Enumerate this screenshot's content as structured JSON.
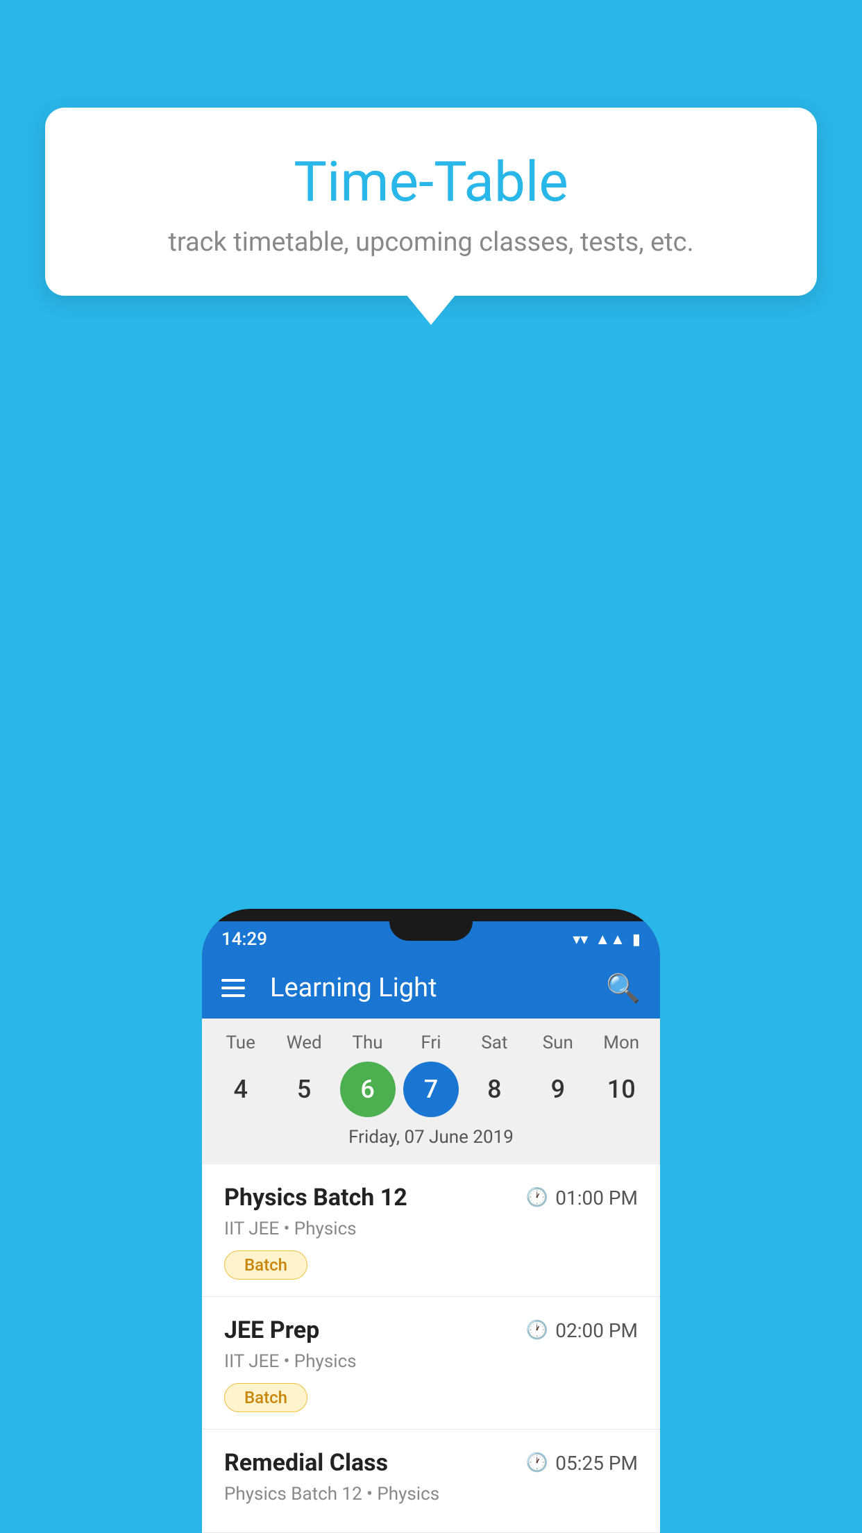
{
  "background_color": "#29B6E8",
  "tooltip": {
    "title": "Time-Table",
    "subtitle": "track timetable, upcoming classes, tests, etc."
  },
  "app": {
    "title": "Learning Light",
    "status_time": "14:29"
  },
  "calendar": {
    "days": [
      {
        "label": "Tue",
        "number": "4"
      },
      {
        "label": "Wed",
        "number": "5"
      },
      {
        "label": "Thu",
        "number": "6",
        "state": "today"
      },
      {
        "label": "Fri",
        "number": "7",
        "state": "selected"
      },
      {
        "label": "Sat",
        "number": "8"
      },
      {
        "label": "Sun",
        "number": "9"
      },
      {
        "label": "Mon",
        "number": "10"
      }
    ],
    "selected_date_label": "Friday, 07 June 2019"
  },
  "schedule_items": [
    {
      "title": "Physics Batch 12",
      "time": "01:00 PM",
      "meta": "IIT JEE • Physics",
      "tag": "Batch"
    },
    {
      "title": "JEE Prep",
      "time": "02:00 PM",
      "meta": "IIT JEE • Physics",
      "tag": "Batch"
    },
    {
      "title": "Remedial Class",
      "time": "05:25 PM",
      "meta": "Physics Batch 12 • Physics",
      "tag": null
    }
  ]
}
